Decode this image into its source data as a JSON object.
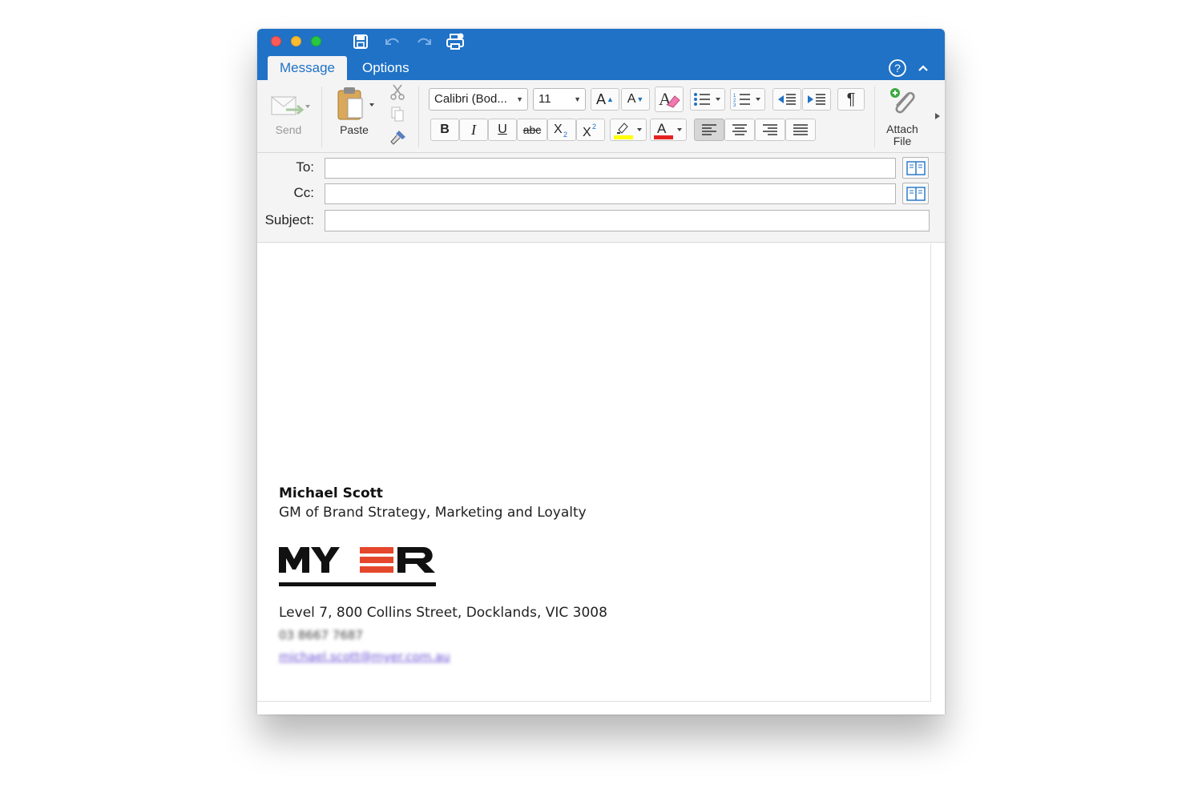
{
  "window": {
    "traffic_lights": [
      "close",
      "minimize",
      "zoom"
    ],
    "quick_access": [
      "save-icon",
      "undo-icon",
      "redo-icon",
      "print-icon"
    ]
  },
  "tabs": [
    {
      "label": "Message",
      "active": true
    },
    {
      "label": "Options",
      "active": false
    }
  ],
  "ribbon": {
    "send_label": "Send",
    "paste_label": "Paste",
    "font_name": "Calibri (Bod...",
    "font_size": "11",
    "attach_label_1": "Attach",
    "attach_label_2": "File",
    "bold": "B",
    "italic": "I",
    "underline": "U",
    "strike": "abc",
    "pilcrow": "¶",
    "grow_font": "A",
    "shrink_font": "A",
    "font_color_glyph": "A",
    "highlight_color": "#ffff00",
    "font_color": "#e52222",
    "alignment": "left"
  },
  "headers": {
    "to_label": "To:",
    "cc_label": "Cc:",
    "subject_label": "Subject:",
    "to_value": "",
    "cc_value": "",
    "subject_value": ""
  },
  "signature": {
    "name": "Michael Scott",
    "title": "GM of Brand Strategy, Marketing and Loyalty",
    "logo_text": "MYER",
    "logo_colors": {
      "text": "#111111",
      "bar": "#e4472c"
    },
    "address": "Level 7, 800 Collins Street, Docklands, VIC 3008",
    "phone": "03 8667 7687",
    "email": "michael.scott@myer.com.au"
  },
  "colors": {
    "titlebar": "#1f72c6",
    "ribbon": "#f4f4f4"
  }
}
